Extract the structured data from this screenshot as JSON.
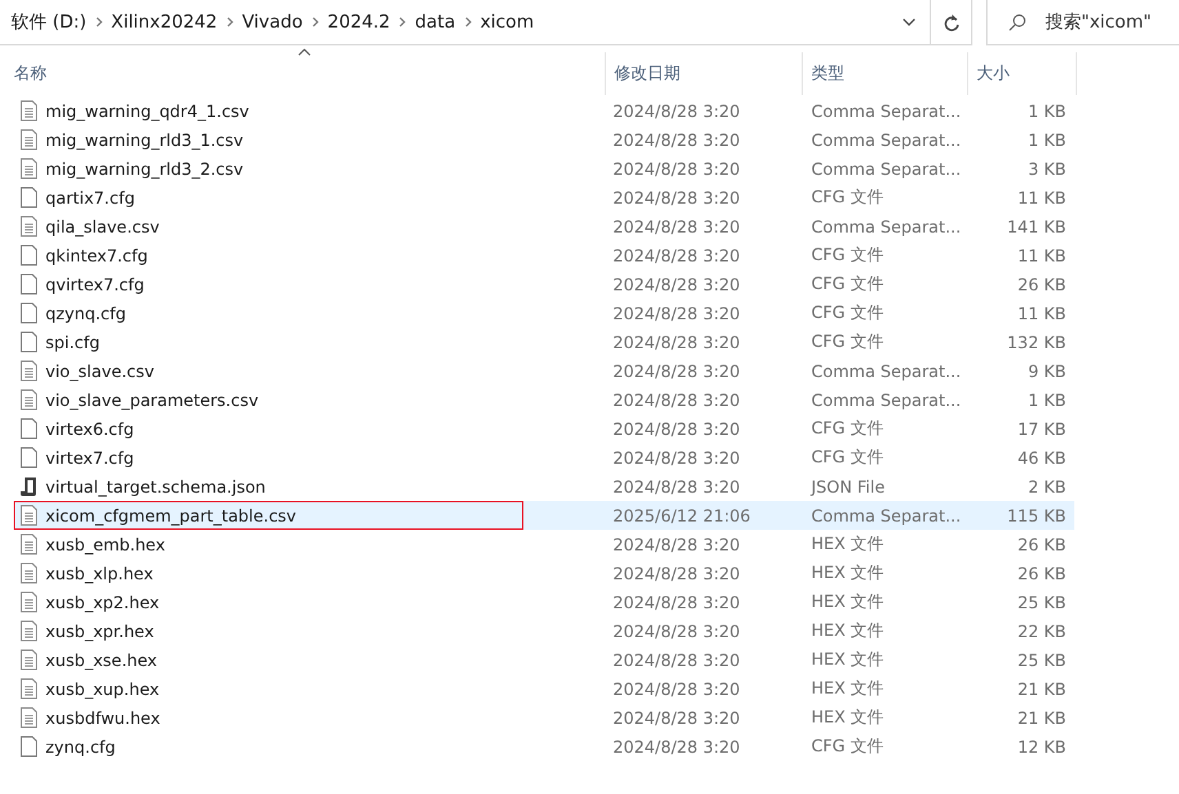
{
  "address_bar": {
    "crumbs": [
      "软件 (D:)",
      "Xilinx20242",
      "Vivado",
      "2024.2",
      "data",
      "xicom"
    ]
  },
  "search": {
    "placeholder": "搜索\"xicom\""
  },
  "columns": [
    "名称",
    "修改日期",
    "类型",
    "大小"
  ],
  "rows": [
    {
      "kind": "file",
      "name": "mig_warning_qdr4_1.csv",
      "date": "2024/8/28 3:20",
      "type": "Comma Separat...",
      "size": "1 KB",
      "selected": false,
      "annotated": false
    },
    {
      "kind": "file",
      "name": "mig_warning_rld3_1.csv",
      "date": "2024/8/28 3:20",
      "type": "Comma Separat...",
      "size": "1 KB",
      "selected": false,
      "annotated": false
    },
    {
      "kind": "file",
      "name": "mig_warning_rld3_2.csv",
      "date": "2024/8/28 3:20",
      "type": "Comma Separat...",
      "size": "3 KB",
      "selected": false,
      "annotated": false
    },
    {
      "kind": "blank",
      "name": "qartix7.cfg",
      "date": "2024/8/28 3:20",
      "type": "CFG 文件",
      "size": "11 KB",
      "selected": false,
      "annotated": false
    },
    {
      "kind": "file",
      "name": "qila_slave.csv",
      "date": "2024/8/28 3:20",
      "type": "Comma Separat...",
      "size": "141 KB",
      "selected": false,
      "annotated": false
    },
    {
      "kind": "blank",
      "name": "qkintex7.cfg",
      "date": "2024/8/28 3:20",
      "type": "CFG 文件",
      "size": "11 KB",
      "selected": false,
      "annotated": false
    },
    {
      "kind": "blank",
      "name": "qvirtex7.cfg",
      "date": "2024/8/28 3:20",
      "type": "CFG 文件",
      "size": "26 KB",
      "selected": false,
      "annotated": false
    },
    {
      "kind": "blank",
      "name": "qzynq.cfg",
      "date": "2024/8/28 3:20",
      "type": "CFG 文件",
      "size": "11 KB",
      "selected": false,
      "annotated": false
    },
    {
      "kind": "blank",
      "name": "spi.cfg",
      "date": "2024/8/28 3:20",
      "type": "CFG 文件",
      "size": "132 KB",
      "selected": false,
      "annotated": false
    },
    {
      "kind": "file",
      "name": "vio_slave.csv",
      "date": "2024/8/28 3:20",
      "type": "Comma Separat...",
      "size": "9 KB",
      "selected": false,
      "annotated": false
    },
    {
      "kind": "file",
      "name": "vio_slave_parameters.csv",
      "date": "2024/8/28 3:20",
      "type": "Comma Separat...",
      "size": "1 KB",
      "selected": false,
      "annotated": false
    },
    {
      "kind": "blank",
      "name": "virtex6.cfg",
      "date": "2024/8/28 3:20",
      "type": "CFG 文件",
      "size": "17 KB",
      "selected": false,
      "annotated": false
    },
    {
      "kind": "blank",
      "name": "virtex7.cfg",
      "date": "2024/8/28 3:20",
      "type": "CFG 文件",
      "size": "46 KB",
      "selected": false,
      "annotated": false
    },
    {
      "kind": "script",
      "name": "virtual_target.schema.json",
      "date": "2024/8/28 3:20",
      "type": "JSON File",
      "size": "2 KB",
      "selected": false,
      "annotated": false
    },
    {
      "kind": "file",
      "name": "xicom_cfgmem_part_table.csv",
      "date": "2025/6/12 21:06",
      "type": "Comma Separat...",
      "size": "115 KB",
      "selected": true,
      "annotated": true
    },
    {
      "kind": "file",
      "name": "xusb_emb.hex",
      "date": "2024/8/28 3:20",
      "type": "HEX 文件",
      "size": "26 KB",
      "selected": false,
      "annotated": false
    },
    {
      "kind": "file",
      "name": "xusb_xlp.hex",
      "date": "2024/8/28 3:20",
      "type": "HEX 文件",
      "size": "26 KB",
      "selected": false,
      "annotated": false
    },
    {
      "kind": "file",
      "name": "xusb_xp2.hex",
      "date": "2024/8/28 3:20",
      "type": "HEX 文件",
      "size": "25 KB",
      "selected": false,
      "annotated": false
    },
    {
      "kind": "file",
      "name": "xusb_xpr.hex",
      "date": "2024/8/28 3:20",
      "type": "HEX 文件",
      "size": "22 KB",
      "selected": false,
      "annotated": false
    },
    {
      "kind": "file",
      "name": "xusb_xse.hex",
      "date": "2024/8/28 3:20",
      "type": "HEX 文件",
      "size": "25 KB",
      "selected": false,
      "annotated": false
    },
    {
      "kind": "file",
      "name": "xusb_xup.hex",
      "date": "2024/8/28 3:20",
      "type": "HEX 文件",
      "size": "21 KB",
      "selected": false,
      "annotated": false
    },
    {
      "kind": "file",
      "name": "xusbdfwu.hex",
      "date": "2024/8/28 3:20",
      "type": "HEX 文件",
      "size": "21 KB",
      "selected": false,
      "annotated": false
    },
    {
      "kind": "blank",
      "name": "zynq.cfg",
      "date": "2024/8/28 3:20",
      "type": "CFG 文件",
      "size": "12 KB",
      "selected": false,
      "annotated": false
    }
  ]
}
